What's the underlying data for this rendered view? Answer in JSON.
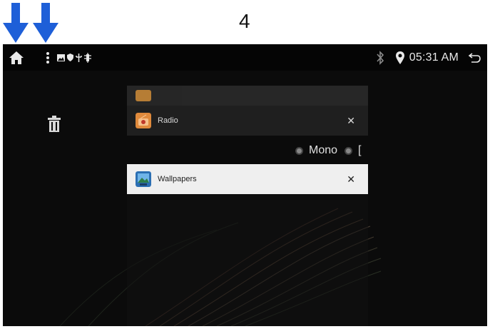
{
  "annotation": {
    "step_number": "4"
  },
  "statusbar": {
    "time": "05:31 AM",
    "icons": [
      "home-icon",
      "overflow-menu-icon",
      "image-icon",
      "shield-icon",
      "usb-icon",
      "debug-icon",
      "bluetooth-icon",
      "location-icon",
      "back-icon"
    ]
  },
  "recents": {
    "cards": [
      {
        "title": "Radio",
        "close": "✕",
        "icon": "radio-app-icon"
      },
      {
        "title": "Wallpapers",
        "close": "✕",
        "icon": "wallpapers-app-icon"
      }
    ],
    "clear_all_icon": "trash-icon"
  },
  "background_app": {
    "option_mono": "Mono",
    "option_second_partial": "["
  },
  "colors": {
    "arrow": "#1e5fd8",
    "statusbar": "#050505",
    "screen_bg": "#0b0b0b",
    "card_light": "#efefef",
    "card_dark": "#1f1f1f"
  }
}
